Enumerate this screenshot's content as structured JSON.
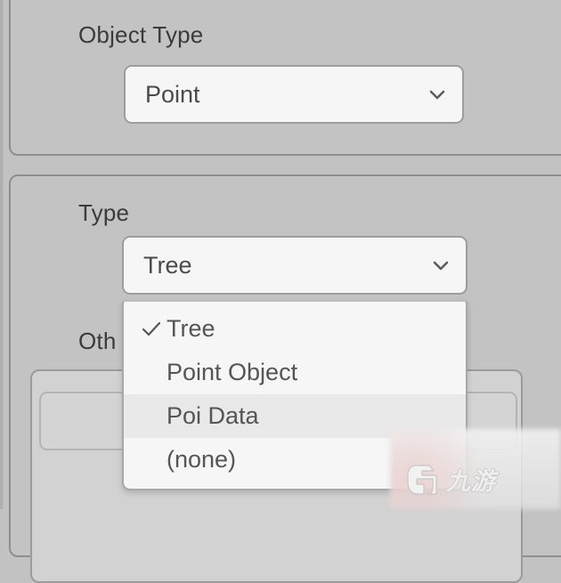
{
  "window": {
    "background_color": "#c2c2c2"
  },
  "panels": {
    "object_type_panel": {
      "name": "Object Type group"
    },
    "type_panel": {
      "name": "Type group"
    }
  },
  "fields": {
    "object_type": {
      "label": "Object Type",
      "selected_value": "Point",
      "chevron_icon": "chevron-down-icon"
    },
    "type": {
      "label": "Type",
      "selected_value": "Tree",
      "chevron_icon": "chevron-down-icon",
      "expanded": true
    },
    "other": {
      "label": "Oth"
    }
  },
  "type_menu": {
    "check_icon": "check-icon",
    "items": [
      {
        "label": "Tree",
        "checked": true,
        "highlighted": false
      },
      {
        "label": "Point Object",
        "checked": false,
        "highlighted": false
      },
      {
        "label": "Poi Data",
        "checked": false,
        "highlighted": true
      },
      {
        "label": "(none)",
        "checked": false,
        "highlighted": false
      }
    ]
  },
  "watermark": {
    "text": "九游",
    "logo_icon": "jiuyou-g-logo-icon"
  },
  "colors": {
    "panel_background": "#c3c3c3",
    "panel_border": "#8e8e8e",
    "control_background": "#f6f6f6",
    "control_border": "#9d9d9d",
    "text": "#4a4a4a",
    "label_text": "#3b3b3b",
    "menu_highlight": "#e9e9e9"
  }
}
